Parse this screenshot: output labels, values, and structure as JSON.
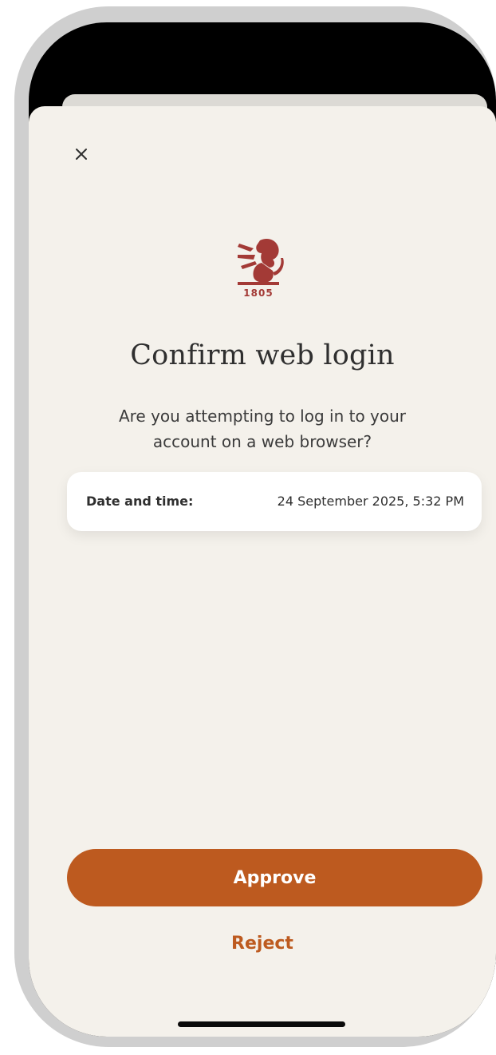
{
  "close": {
    "icon": "close-icon"
  },
  "logo": {
    "year": "1805",
    "icon": "lion-emblem-icon"
  },
  "title": "Confirm web login",
  "subtitle": "Are you attempting to log in to your account on a web browser?",
  "info": {
    "label": "Date and time:",
    "value": "24 September 2025, 5:32 PM"
  },
  "actions": {
    "approve_label": "Approve",
    "reject_label": "Reject"
  },
  "colors": {
    "accent": "#bd5a1f",
    "background": "#f4f1eb",
    "logo": "#a33a36"
  }
}
